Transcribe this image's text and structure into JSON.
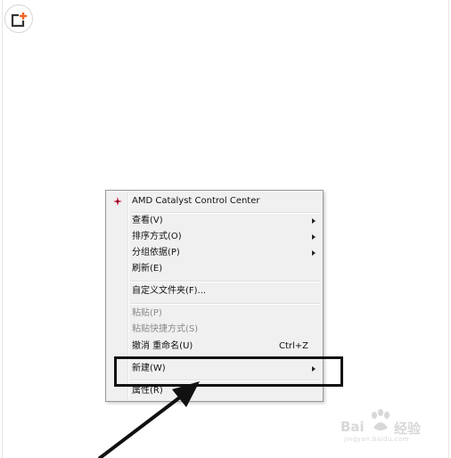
{
  "logo": {
    "icon": "plus-square-icon",
    "accent": "#f26522"
  },
  "context_menu": {
    "items": [
      {
        "label": "AMD Catalyst Control Center",
        "shortcut": "",
        "submenu": false,
        "disabled": false,
        "icon": "amd-catalyst-icon"
      },
      {
        "label": "查看(V)",
        "shortcut": "",
        "submenu": true,
        "disabled": false
      },
      {
        "label": "排序方式(O)",
        "shortcut": "",
        "submenu": true,
        "disabled": false
      },
      {
        "label": "分组依据(P)",
        "shortcut": "",
        "submenu": true,
        "disabled": false
      },
      {
        "label": "刷新(E)",
        "shortcut": "",
        "submenu": false,
        "disabled": false
      },
      {
        "label": "自定义文件夹(F)...",
        "shortcut": "",
        "submenu": false,
        "disabled": false
      },
      {
        "label": "粘贴(P)",
        "shortcut": "",
        "submenu": false,
        "disabled": true
      },
      {
        "label": "粘贴快捷方式(S)",
        "shortcut": "",
        "submenu": false,
        "disabled": true
      },
      {
        "label": "撤消 重命名(U)",
        "shortcut": "Ctrl+Z",
        "submenu": false,
        "disabled": false
      },
      {
        "label": "新建(W)",
        "shortcut": "",
        "submenu": true,
        "disabled": false
      },
      {
        "label": "属性(R)",
        "shortcut": "",
        "submenu": false,
        "disabled": false
      }
    ]
  },
  "annotation": {
    "color": "#111111",
    "highlighted_item": "新建(W)"
  },
  "watermark": {
    "brand": "Bai",
    "brand_suffix": "经验",
    "url": "jingyan.baidu.com",
    "color": "#d8d8d8"
  }
}
